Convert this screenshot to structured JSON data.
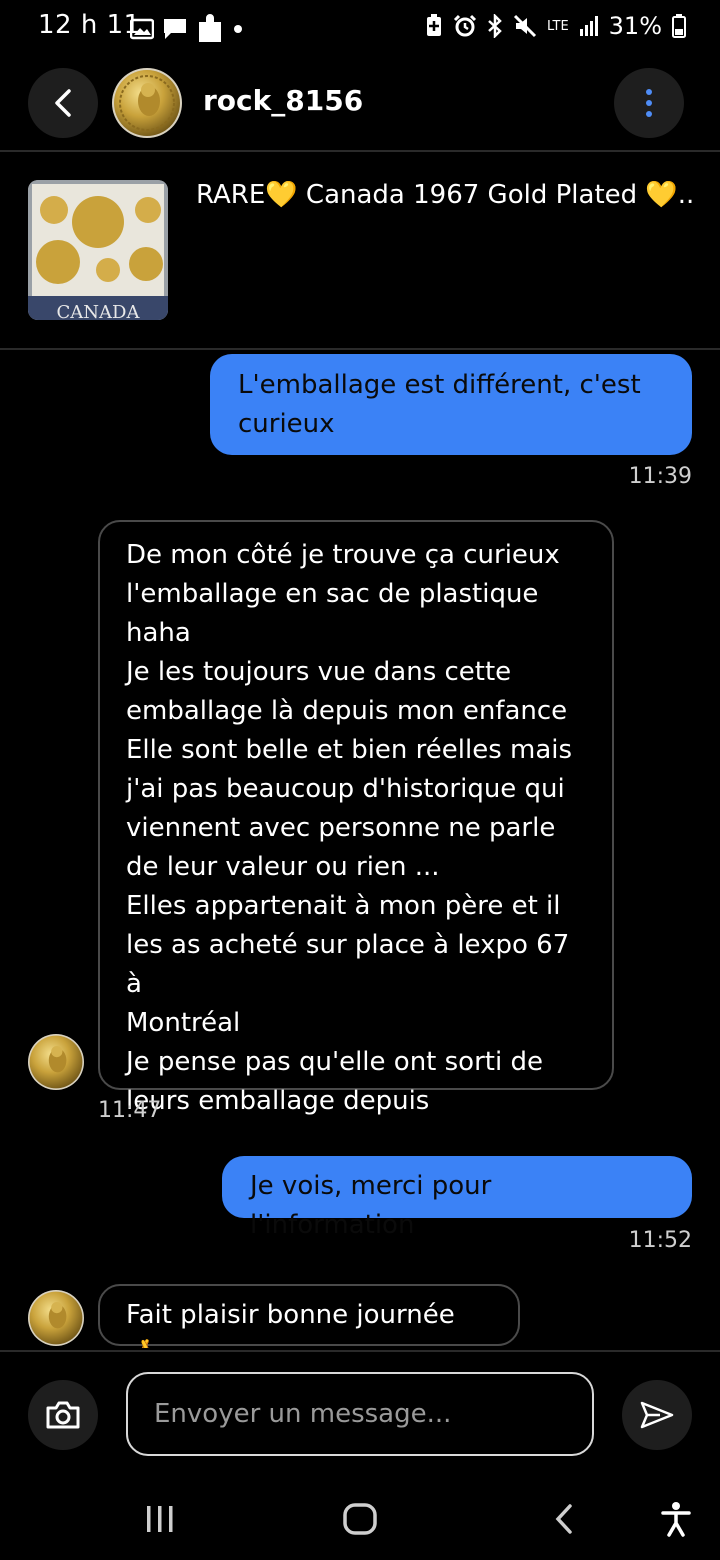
{
  "status_bar": {
    "time": "12 h 11",
    "network": "LTE",
    "battery": "31%"
  },
  "header": {
    "username": "rock_8156"
  },
  "listing": {
    "title": "RARE💛 Canada 1967 Gold Plated 💛...",
    "thumb_banner": "CANADA"
  },
  "messages": [
    {
      "direction": "outgoing",
      "lines": [
        "L'emballage est différent, c'est",
        "curieux"
      ],
      "time": "11:39"
    },
    {
      "direction": "incoming",
      "lines": [
        "De mon côté je trouve ça curieux",
        "l'emballage en sac de plastique",
        "haha",
        "Je les toujours vue dans cette",
        "emballage là depuis mon enfance",
        "Elle sont belle et bien réelles mais",
        "j'ai pas beaucoup d'historique qui",
        "viennent avec personne ne parle",
        "de leur valeur ou rien ...",
        "Elles appartenait à mon père et il",
        "les as acheté sur place à lexpo 67 à",
        "Montréal",
        "Je pense pas qu'elle ont sorti de",
        "leurs emballage depuis"
      ],
      "time": "11:47"
    },
    {
      "direction": "outgoing",
      "lines": [
        "Je vois, merci pour l'information"
      ],
      "time": "11:52"
    },
    {
      "direction": "incoming",
      "lines": [
        "Fait plaisir bonne journée 🤞"
      ],
      "time": ""
    }
  ],
  "composer": {
    "placeholder": "Envoyer un message..."
  },
  "colors": {
    "background": "#000000",
    "outgoing_bubble": "#3b82f6",
    "incoming_border": "#4a4a4a",
    "menu_dots": "#4f8df7"
  },
  "icons": {
    "back": "chevron-left-icon",
    "menu": "vertical-dots-icon",
    "camera": "camera-icon",
    "send": "send-icon",
    "nav_recents": "recents-icon",
    "nav_home": "home-icon",
    "nav_back": "nav-back-icon",
    "nav_accessibility": "accessibility-icon"
  }
}
